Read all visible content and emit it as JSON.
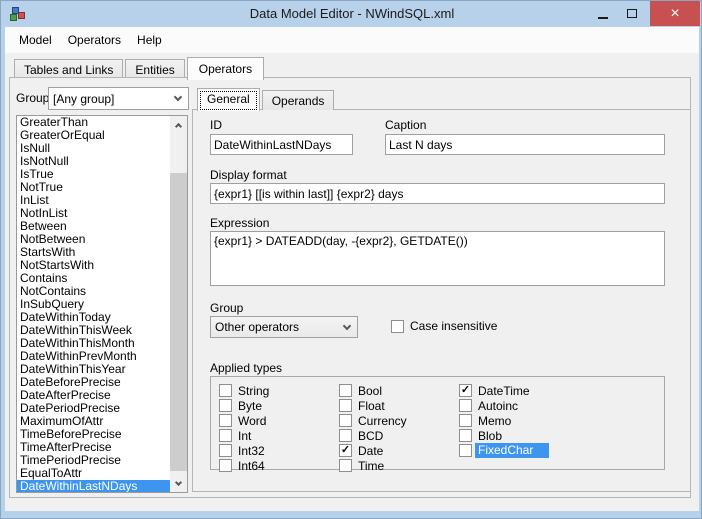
{
  "window": {
    "title": "Data Model Editor - NWindSQL.xml",
    "close_glyph": "×"
  },
  "menu": {
    "items": [
      {
        "label": "Model"
      },
      {
        "label": "Operators"
      },
      {
        "label": "Help"
      }
    ]
  },
  "tabs": [
    {
      "label": "Tables and Links",
      "active": false
    },
    {
      "label": "Entities",
      "active": false
    },
    {
      "label": "Operators",
      "active": true
    }
  ],
  "left_panel": {
    "group_label": "Group:",
    "group_value": "[Any group]",
    "selected_operator": "DateWithinLastNDays",
    "operators": [
      "GreaterThan",
      "GreaterOrEqual",
      "IsNull",
      "IsNotNull",
      "IsTrue",
      "NotTrue",
      "InList",
      "NotInList",
      "Between",
      "NotBetween",
      "StartsWith",
      "NotStartsWith",
      "Contains",
      "NotContains",
      "InSubQuery",
      "DateWithinToday",
      "DateWithinThisWeek",
      "DateWithinThisMonth",
      "DateWithinPrevMonth",
      "DateWithinThisYear",
      "DateBeforePrecise",
      "DateAfterPrecise",
      "DatePeriodPrecise",
      "MaximumOfAttr",
      "TimeBeforePrecise",
      "TimeAfterPrecise",
      "TimePeriodPrecise",
      "EqualToAttr",
      "DateWithinLastNDays"
    ]
  },
  "detail": {
    "tabs": [
      {
        "label": "General",
        "active": true
      },
      {
        "label": "Operands",
        "active": false
      }
    ],
    "id_label": "ID",
    "id_value": "DateWithinLastNDays",
    "caption_label": "Caption",
    "caption_value": "Last N days",
    "display_format_label": "Display format",
    "display_format_value": "{expr1} [[is within last]] {expr2} days",
    "expression_label": "Expression",
    "expression_value": "{expr1} > DATEADD(day, -{expr2}, GETDATE())",
    "group_label": "Group",
    "group_value": "Other operators",
    "case_insensitive_label": "Case insensitive",
    "case_insensitive_checked": false,
    "applied_types_label": "Applied types",
    "applied_types_columns": [
      [
        {
          "label": "String",
          "checked": false
        },
        {
          "label": "Byte",
          "checked": false
        },
        {
          "label": "Word",
          "checked": false
        },
        {
          "label": "Int",
          "checked": false
        },
        {
          "label": "Int32",
          "checked": false
        },
        {
          "label": "Int64",
          "checked": false
        }
      ],
      [
        {
          "label": "Bool",
          "checked": false
        },
        {
          "label": "Float",
          "checked": false
        },
        {
          "label": "Currency",
          "checked": false
        },
        {
          "label": "BCD",
          "checked": false
        },
        {
          "label": "Date",
          "checked": true
        },
        {
          "label": "Time",
          "checked": false
        }
      ],
      [
        {
          "label": "DateTime",
          "checked": true
        },
        {
          "label": "Autoinc",
          "checked": false
        },
        {
          "label": "Memo",
          "checked": false
        },
        {
          "label": "Blob",
          "checked": false
        },
        {
          "label": "FixedChar",
          "checked": false,
          "highlighted": true
        }
      ]
    ]
  },
  "colors": {
    "titlebar": "#b8d1ea",
    "close_button": "#c75050",
    "selection": "#3d95f0",
    "dialog_bg": "#f0f0f0"
  }
}
